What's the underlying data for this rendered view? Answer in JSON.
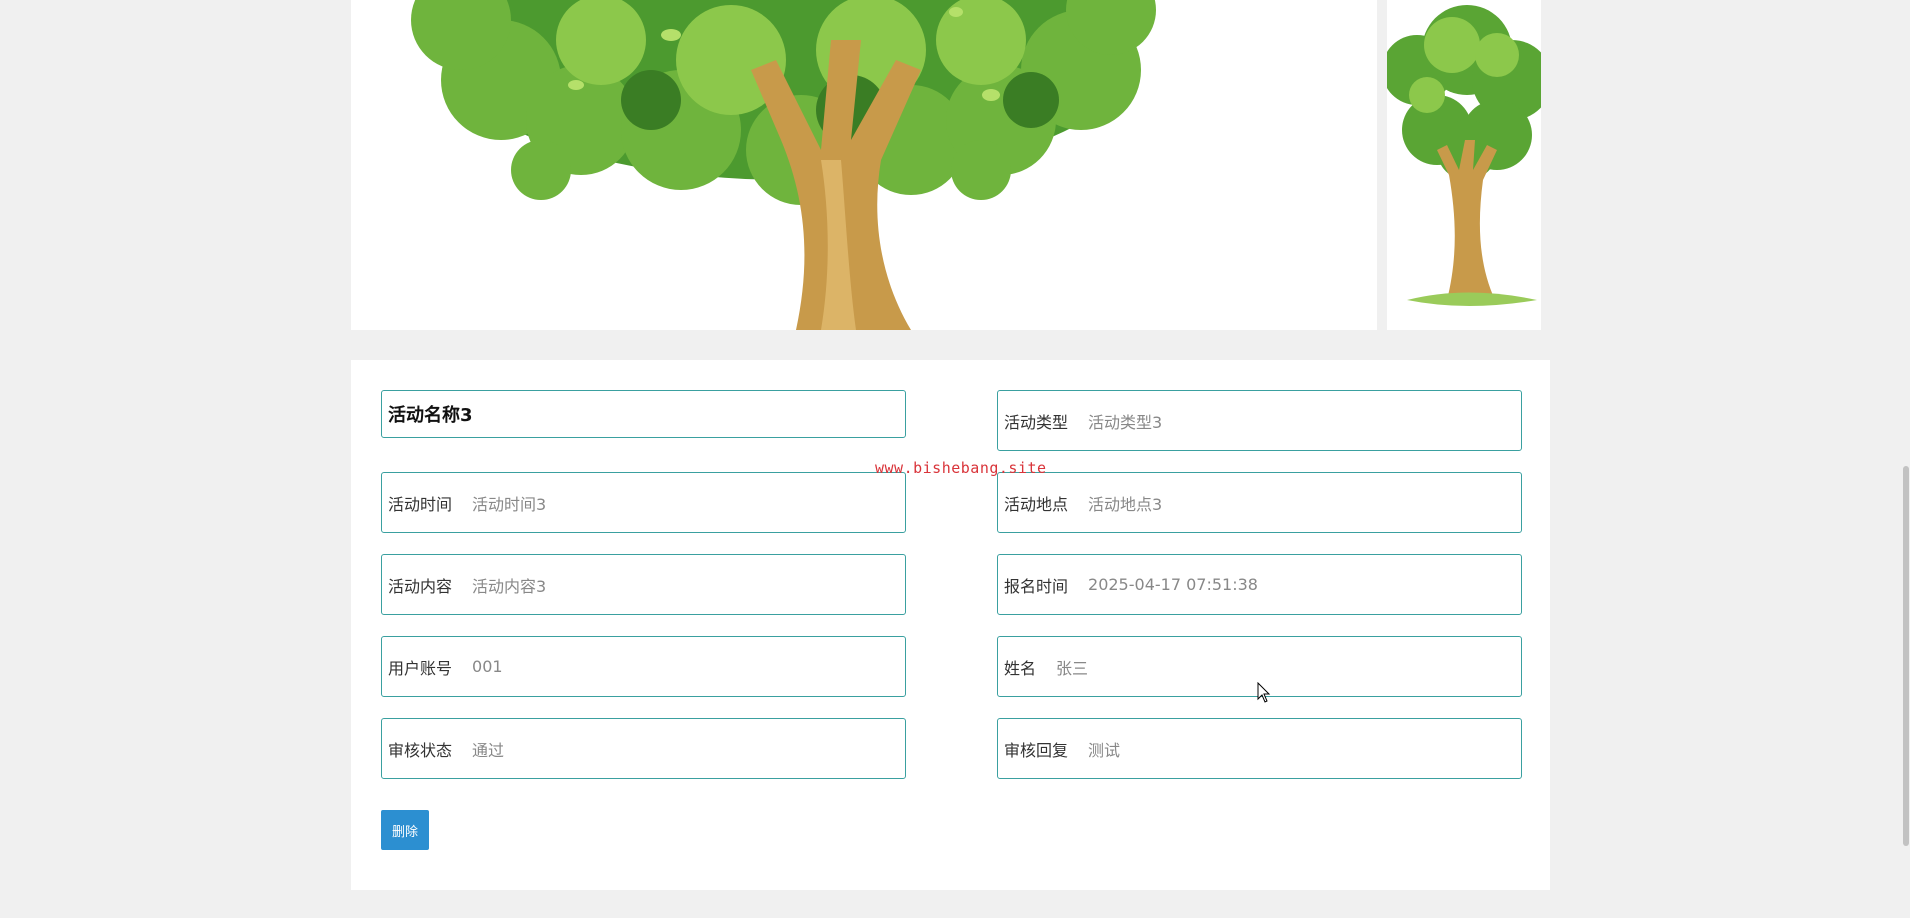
{
  "watermark": "www.bishebang.site",
  "detail": {
    "title": "活动名称3",
    "fields": {
      "activity_type": {
        "label": "活动类型",
        "value": "活动类型3"
      },
      "activity_time": {
        "label": "活动时间",
        "value": "活动时间3"
      },
      "activity_location": {
        "label": "活动地点",
        "value": "活动地点3"
      },
      "activity_content": {
        "label": "活动内容",
        "value": "活动内容3"
      },
      "signup_time": {
        "label": "报名时间",
        "value": "2025-04-17 07:51:38"
      },
      "user_account": {
        "label": "用户账号",
        "value": "001"
      },
      "name": {
        "label": "姓名",
        "value": "张三"
      },
      "review_status": {
        "label": "审核状态",
        "value": "通过"
      },
      "review_reply": {
        "label": "审核回复",
        "value": "测试"
      }
    },
    "delete_label": "删除"
  },
  "colors": {
    "field_border": "#3aa0a0",
    "button_bg": "#2c8fd1",
    "watermark": "#d9343a",
    "page_bg": "#f0f0f0"
  }
}
